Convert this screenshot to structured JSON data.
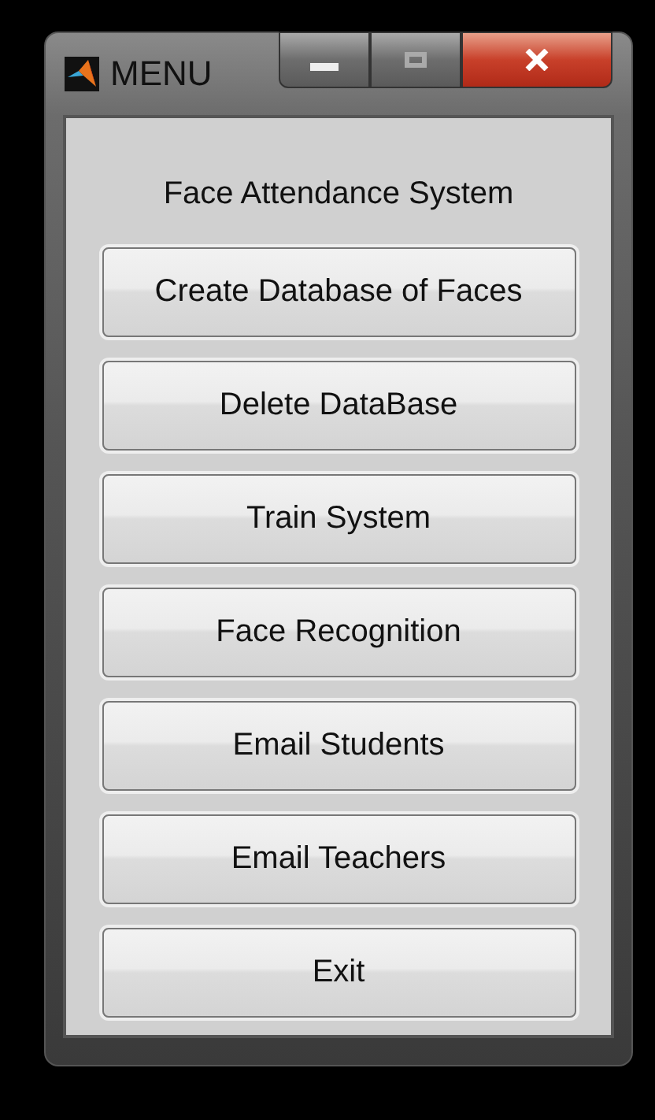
{
  "window": {
    "title": "MENU"
  },
  "heading": "Face Attendance System",
  "buttons": [
    "Create Database of Faces",
    "Delete DataBase",
    "Train System",
    "Face Recognition",
    "Email Students",
    "Email Teachers",
    "Exit"
  ]
}
